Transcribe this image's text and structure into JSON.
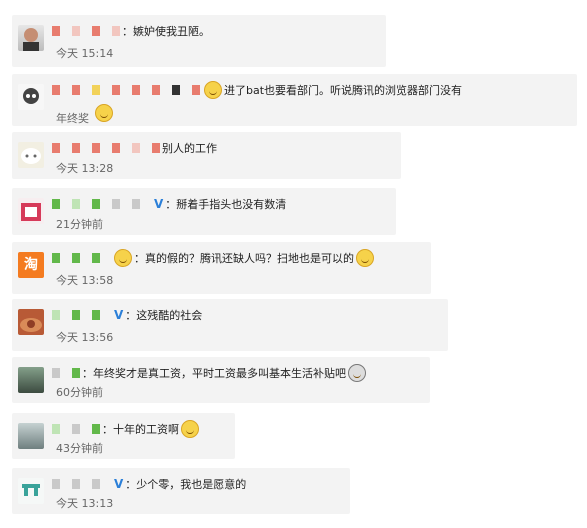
{
  "comments": [
    {
      "text": "：嫉妒使我丑陋。",
      "time": "今天 15:14"
    },
    {
      "text": "进了bat也要看部门。听说腾讯的浏览器部门没有",
      "text2": "年终奖",
      "time": ""
    },
    {
      "text": "别人的工作",
      "time": "今天 13:28"
    },
    {
      "text": "：掰着手指头也没有数清",
      "time": "21分钟前"
    },
    {
      "text": "：真的假的？腾讯还缺人吗？扫地也是可以的",
      "time": "今天 13:58"
    },
    {
      "text": "：这残酷的社会",
      "time": "今天 13:56"
    },
    {
      "text": "：年终奖才是真工资，平时工资最多叫基本生活补贴吧",
      "time": "60分钟前"
    },
    {
      "text": "：十年的工资啊",
      "time": "43分钟前"
    },
    {
      "text": "：少个零，我也是愿意的",
      "time": "今天 13:13"
    }
  ],
  "verified_mark": "V",
  "icons": {
    "taobao": "淘"
  }
}
